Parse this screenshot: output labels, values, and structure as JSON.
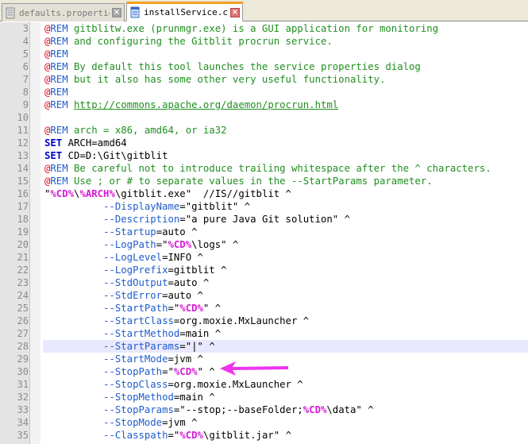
{
  "tabs": [
    {
      "label": "defaults.properties",
      "active": false,
      "icon": "document-icon"
    },
    {
      "label": "installService.cmd",
      "active": true,
      "icon": "document-icon"
    }
  ],
  "colors": {
    "accent_tab": "#f4a020",
    "annotation_arrow": "#ee33ee",
    "current_line": "#e8e8ff"
  },
  "current_line_number": "28",
  "lines": [
    {
      "n": "3",
      "parts": [
        [
          "at",
          "@"
        ],
        [
          "rem",
          "REM"
        ],
        [
          "comment",
          " gitblitw.exe (prunmgr.exe) is a GUI application for monitoring"
        ]
      ]
    },
    {
      "n": "4",
      "parts": [
        [
          "at",
          "@"
        ],
        [
          "rem",
          "REM"
        ],
        [
          "comment",
          " and configuring the Gitblit procrun service."
        ]
      ]
    },
    {
      "n": "5",
      "parts": [
        [
          "at",
          "@"
        ],
        [
          "rem",
          "REM"
        ]
      ]
    },
    {
      "n": "6",
      "parts": [
        [
          "at",
          "@"
        ],
        [
          "rem",
          "REM"
        ],
        [
          "comment",
          " By default this tool launches the service properties dialog"
        ]
      ]
    },
    {
      "n": "7",
      "parts": [
        [
          "at",
          "@"
        ],
        [
          "rem",
          "REM"
        ],
        [
          "comment",
          " but it also has some other very useful functionality."
        ]
      ]
    },
    {
      "n": "8",
      "parts": [
        [
          "at",
          "@"
        ],
        [
          "rem",
          "REM"
        ]
      ]
    },
    {
      "n": "9",
      "parts": [
        [
          "at",
          "@"
        ],
        [
          "rem",
          "REM"
        ],
        [
          "comment",
          " "
        ],
        [
          "link",
          "http://commons.apache.org/daemon/procrun.html"
        ]
      ]
    },
    {
      "n": "10",
      "parts": []
    },
    {
      "n": "11",
      "parts": [
        [
          "at",
          "@"
        ],
        [
          "rem",
          "REM"
        ],
        [
          "comment",
          " arch = x86, amd64, or ia32"
        ]
      ]
    },
    {
      "n": "12",
      "parts": [
        [
          "set",
          "SET"
        ],
        [
          "plain",
          " ARCH"
        ],
        [
          "op",
          "="
        ],
        [
          "plain",
          "amd64"
        ]
      ]
    },
    {
      "n": "13",
      "parts": [
        [
          "set",
          "SET"
        ],
        [
          "plain",
          " CD"
        ],
        [
          "op",
          "="
        ],
        [
          "plain",
          "D:\\Git\\gitblit"
        ]
      ]
    },
    {
      "n": "14",
      "parts": [
        [
          "at",
          "@"
        ],
        [
          "rem",
          "REM"
        ],
        [
          "comment",
          " Be careful not to introduce trailing whitespace after the ^ characters."
        ]
      ]
    },
    {
      "n": "15",
      "parts": [
        [
          "at",
          "@"
        ],
        [
          "rem",
          "REM"
        ],
        [
          "comment",
          " Use ; or # to separate values in the --StartParams parameter."
        ]
      ]
    },
    {
      "n": "16",
      "parts": [
        [
          "plain",
          "\""
        ],
        [
          "var",
          "%CD%"
        ],
        [
          "plain",
          "\\"
        ],
        [
          "var",
          "%ARCH%"
        ],
        [
          "plain",
          "\\gitblit.exe\"  //IS//gitblit ^"
        ]
      ]
    },
    {
      "n": "17",
      "parts": [
        [
          "plain",
          "          "
        ],
        [
          "param",
          "--DisplayName"
        ],
        [
          "op",
          "="
        ],
        [
          "plain",
          "\"gitblit\" ^"
        ]
      ]
    },
    {
      "n": "18",
      "parts": [
        [
          "plain",
          "          "
        ],
        [
          "param",
          "--Description"
        ],
        [
          "op",
          "="
        ],
        [
          "plain",
          "\"a pure Java Git solution\" ^"
        ]
      ]
    },
    {
      "n": "19",
      "parts": [
        [
          "plain",
          "          "
        ],
        [
          "param",
          "--Startup"
        ],
        [
          "op",
          "="
        ],
        [
          "plain",
          "auto ^"
        ]
      ]
    },
    {
      "n": "20",
      "parts": [
        [
          "plain",
          "          "
        ],
        [
          "param",
          "--LogPath"
        ],
        [
          "op",
          "="
        ],
        [
          "plain",
          "\""
        ],
        [
          "var",
          "%CD%"
        ],
        [
          "plain",
          "\\logs\" ^"
        ]
      ]
    },
    {
      "n": "21",
      "parts": [
        [
          "plain",
          "          "
        ],
        [
          "param",
          "--LogLevel"
        ],
        [
          "op",
          "="
        ],
        [
          "plain",
          "INFO ^"
        ]
      ]
    },
    {
      "n": "22",
      "parts": [
        [
          "plain",
          "          "
        ],
        [
          "param",
          "--LogPrefix"
        ],
        [
          "op",
          "="
        ],
        [
          "plain",
          "gitblit ^"
        ]
      ]
    },
    {
      "n": "23",
      "parts": [
        [
          "plain",
          "          "
        ],
        [
          "param",
          "--StdOutput"
        ],
        [
          "op",
          "="
        ],
        [
          "plain",
          "auto ^"
        ]
      ]
    },
    {
      "n": "24",
      "parts": [
        [
          "plain",
          "          "
        ],
        [
          "param",
          "--StdError"
        ],
        [
          "op",
          "="
        ],
        [
          "plain",
          "auto ^"
        ]
      ]
    },
    {
      "n": "25",
      "parts": [
        [
          "plain",
          "          "
        ],
        [
          "param",
          "--StartPath"
        ],
        [
          "op",
          "="
        ],
        [
          "plain",
          "\""
        ],
        [
          "var",
          "%CD%"
        ],
        [
          "plain",
          "\" ^"
        ]
      ]
    },
    {
      "n": "26",
      "parts": [
        [
          "plain",
          "          "
        ],
        [
          "param",
          "--StartClass"
        ],
        [
          "op",
          "="
        ],
        [
          "plain",
          "org.moxie.MxLauncher ^"
        ]
      ]
    },
    {
      "n": "27",
      "parts": [
        [
          "plain",
          "          "
        ],
        [
          "param",
          "--StartMethod"
        ],
        [
          "op",
          "="
        ],
        [
          "plain",
          "main ^"
        ]
      ]
    },
    {
      "n": "28",
      "parts": [
        [
          "plain",
          "          "
        ],
        [
          "param",
          "--StartParams"
        ],
        [
          "op",
          "="
        ],
        [
          "plain",
          "\"|\" ^"
        ]
      ]
    },
    {
      "n": "29",
      "parts": [
        [
          "plain",
          "          "
        ],
        [
          "param",
          "--StartMode"
        ],
        [
          "op",
          "="
        ],
        [
          "plain",
          "jvm ^"
        ]
      ]
    },
    {
      "n": "30",
      "parts": [
        [
          "plain",
          "          "
        ],
        [
          "param",
          "--StopPath"
        ],
        [
          "op",
          "="
        ],
        [
          "plain",
          "\""
        ],
        [
          "var",
          "%CD%"
        ],
        [
          "plain",
          "\" ^"
        ]
      ]
    },
    {
      "n": "31",
      "parts": [
        [
          "plain",
          "          "
        ],
        [
          "param",
          "--StopClass"
        ],
        [
          "op",
          "="
        ],
        [
          "plain",
          "org.moxie.MxLauncher ^"
        ]
      ]
    },
    {
      "n": "32",
      "parts": [
        [
          "plain",
          "          "
        ],
        [
          "param",
          "--StopMethod"
        ],
        [
          "op",
          "="
        ],
        [
          "plain",
          "main ^"
        ]
      ]
    },
    {
      "n": "33",
      "parts": [
        [
          "plain",
          "          "
        ],
        [
          "param",
          "--StopParams"
        ],
        [
          "op",
          "="
        ],
        [
          "plain",
          "\"--stop;--baseFolder;"
        ],
        [
          "var",
          "%CD%"
        ],
        [
          "plain",
          "\\data\" ^"
        ]
      ]
    },
    {
      "n": "34",
      "parts": [
        [
          "plain",
          "          "
        ],
        [
          "param",
          "--StopMode"
        ],
        [
          "op",
          "="
        ],
        [
          "plain",
          "jvm ^"
        ]
      ]
    },
    {
      "n": "35",
      "parts": [
        [
          "plain",
          "          "
        ],
        [
          "param",
          "--Classpath"
        ],
        [
          "op",
          "="
        ],
        [
          "plain",
          "\""
        ],
        [
          "var",
          "%CD%"
        ],
        [
          "plain",
          "\\gitblit.jar\" ^"
        ]
      ]
    }
  ]
}
